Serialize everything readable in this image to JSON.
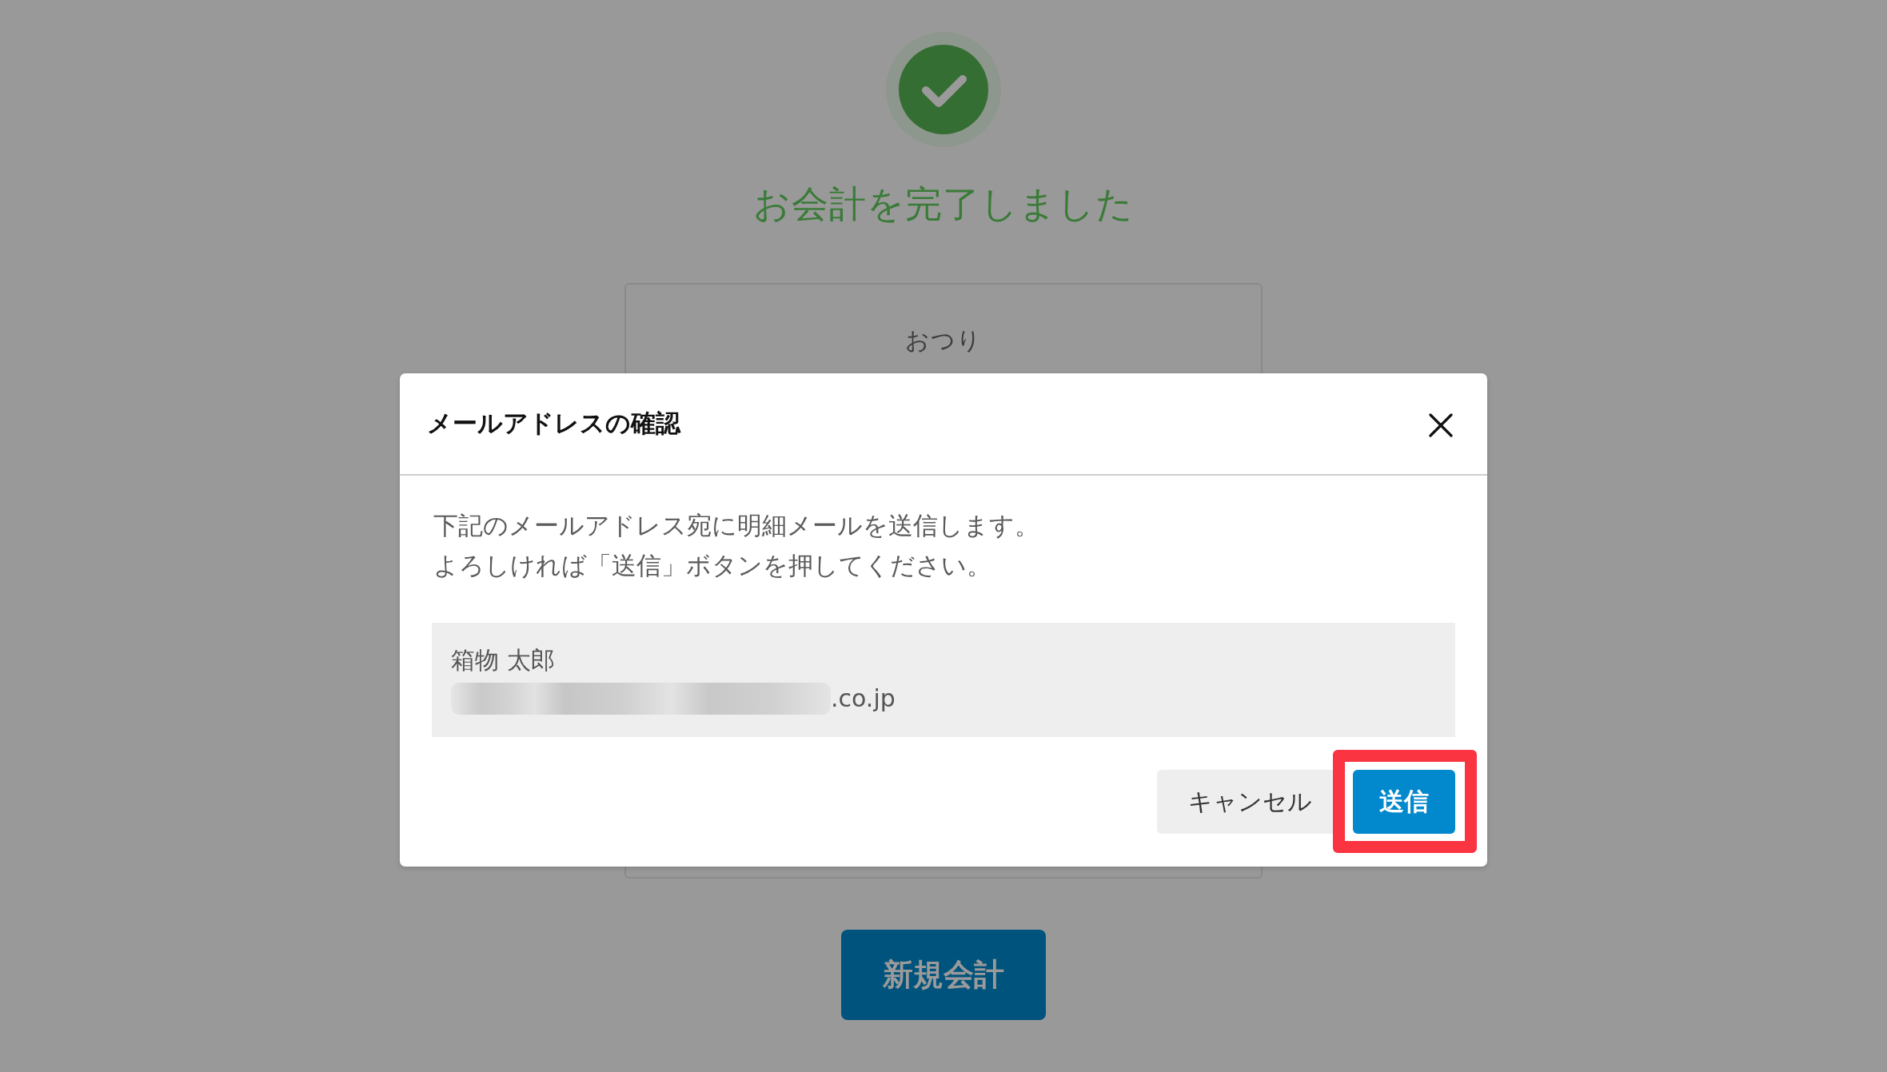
{
  "page": {
    "title": "お会計を完了しました",
    "summary_card": {
      "label": "おつり"
    },
    "new_checkout_button": "新規会計"
  },
  "dialog": {
    "title": "メールアドレスの確認",
    "message": [
      "下記のメールアドレス宛に明細メールを送信します。",
      "よろしければ「送信」ボタンを押してください。"
    ],
    "recipient": {
      "name": "箱物 太郎",
      "email": ".co.jp",
      "email_blurred": true
    },
    "buttons": [
      {
        "label": "キャンセル",
        "kind": "secondary",
        "highlighted": false
      },
      {
        "label": "送信",
        "kind": "primary",
        "highlighted": true
      }
    ]
  }
}
